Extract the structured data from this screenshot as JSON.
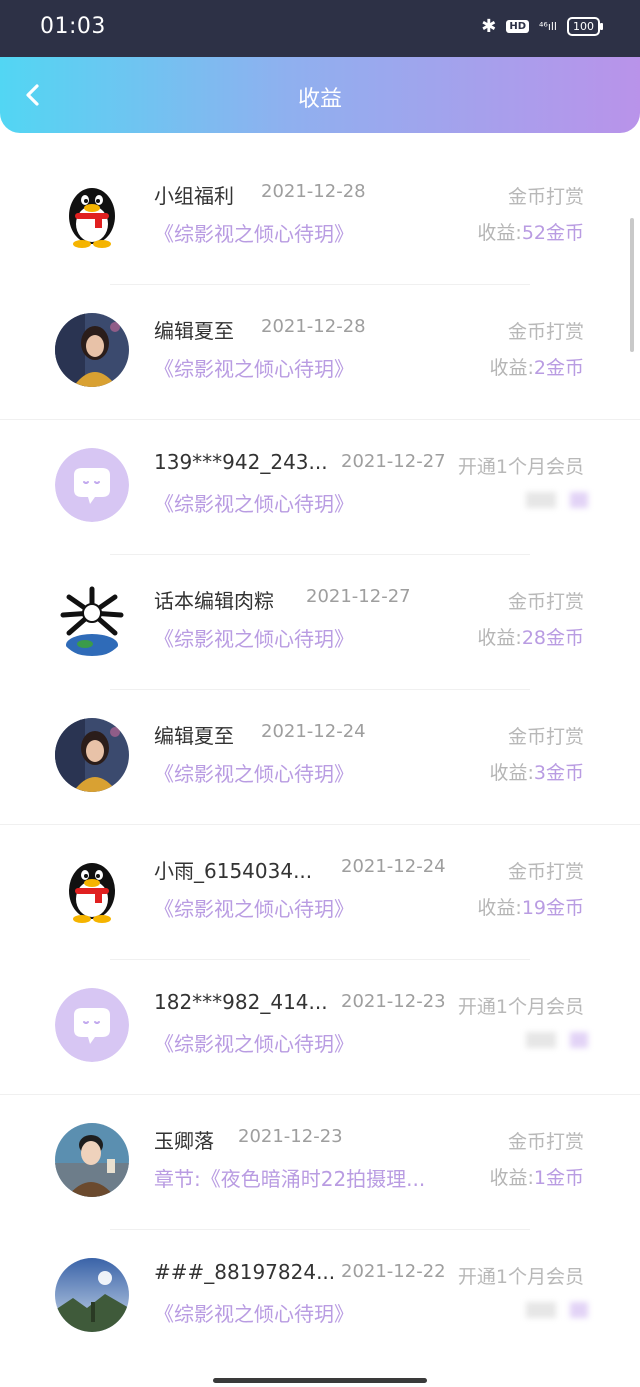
{
  "status_bar": {
    "time": "01:03",
    "bluetooth": "✱",
    "hd": "HD",
    "signal": "⁴⁶ıll",
    "battery": "100"
  },
  "header": {
    "title": "收益",
    "back_icon": "chevron-left-icon"
  },
  "colors": {
    "accent": "#b99ce2",
    "header_start": "#52d6f3",
    "header_end": "#b993ea"
  },
  "rows": [
    {
      "avatar": "qq-penguin",
      "name": "小组福利",
      "date": "2021-12-28",
      "type": "金币打赏",
      "book": "《综影视之倾心待玥》",
      "income_label": "收益:",
      "income_value": "52金币"
    },
    {
      "avatar": "photo-woman",
      "name": "编辑夏至",
      "date": "2021-12-28",
      "type": "金币打赏",
      "book": "《综影视之倾心待玥》",
      "income_label": "收益:",
      "income_value": "2金币"
    },
    {
      "avatar": "chat-bubble",
      "name": "139***942_243...",
      "date": "2021-12-27",
      "type": "开通1个月会员",
      "book": "《综影视之倾心待玥》",
      "income_label": "",
      "income_value": ""
    },
    {
      "avatar": "bone-globe",
      "name": "话本编辑肉粽",
      "date": "2021-12-27",
      "type": "金币打赏",
      "book": "《综影视之倾心待玥》",
      "income_label": "收益:",
      "income_value": "28金币"
    },
    {
      "avatar": "photo-woman",
      "name": "编辑夏至",
      "date": "2021-12-24",
      "type": "金币打赏",
      "book": "《综影视之倾心待玥》",
      "income_label": "收益:",
      "income_value": "3金币"
    },
    {
      "avatar": "qq-penguin",
      "name": "小雨_6154034...",
      "date": "2021-12-24",
      "type": "金币打赏",
      "book": "《综影视之倾心待玥》",
      "income_label": "收益:",
      "income_value": "19金币"
    },
    {
      "avatar": "chat-bubble",
      "name": "182***982_414...",
      "date": "2021-12-23",
      "type": "开通1个月会员",
      "book": "《综影视之倾心待玥》",
      "income_label": "",
      "income_value": ""
    },
    {
      "avatar": "photo-man",
      "name": "玉卿落",
      "date": "2021-12-23",
      "type": "金币打赏",
      "book": "章节:《夜色暗涌时22拍摄理...",
      "income_label": "收益:",
      "income_value": "1金币"
    },
    {
      "avatar": "photo-landscape",
      "name": "###_88197824...",
      "date": "2021-12-22",
      "type": "开通1个月会员",
      "book": "《综影视之倾心待玥》",
      "income_label": "",
      "income_value": ""
    }
  ]
}
